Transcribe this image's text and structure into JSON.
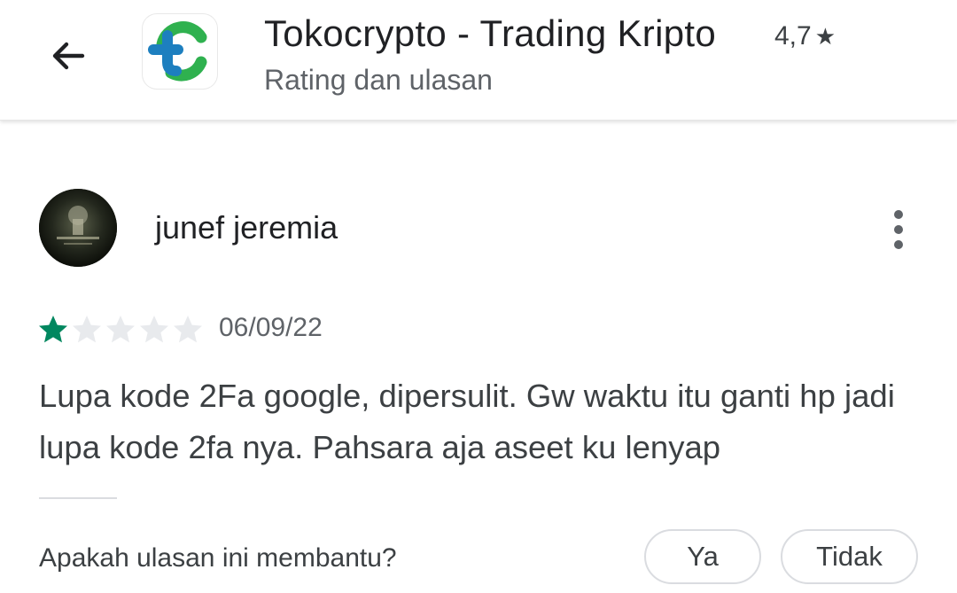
{
  "header": {
    "back_icon": "arrow-back-icon",
    "app_icon": "tokocrypto-logo",
    "app_title": "Tokocrypto - Trading Kripto",
    "rating": "4,7",
    "rating_star": "★",
    "subtitle": "Rating dan ulasan"
  },
  "review": {
    "reviewer_name": "junef jeremia",
    "star_rating": 1,
    "max_stars": 5,
    "date": "06/09/22",
    "text": "Lupa kode 2Fa google, dipersulit. Gw waktu itu ganti hp jadi lupa kode 2fa nya. Pahsara aja aseet ku lenyap",
    "more_icon": "more-vert-icon"
  },
  "helpful": {
    "question": "Apakah ulasan ini membantu?",
    "yes_label": "Ya",
    "no_label": "Tidak"
  },
  "colors": {
    "star_filled": "#01875f",
    "star_empty": "#e8eaed",
    "logo_blue": "#1d7fbf",
    "logo_green": "#2fb14f"
  }
}
